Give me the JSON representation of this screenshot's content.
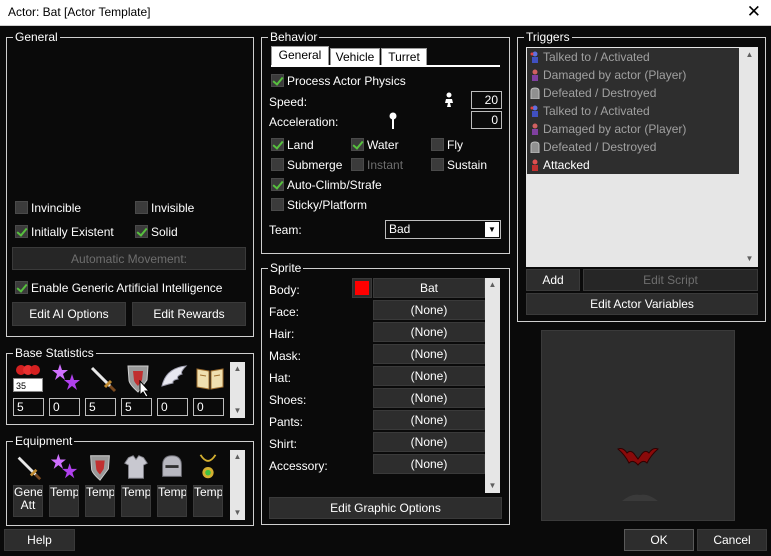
{
  "window": {
    "title": "Actor: Bat [Actor Template]"
  },
  "general": {
    "legend": "General",
    "invincible": {
      "label": "Invincible",
      "checked": false
    },
    "invisible": {
      "label": "Invisible",
      "checked": false
    },
    "initially_existent": {
      "label": "Initially Existent",
      "checked": true
    },
    "solid": {
      "label": "Solid",
      "checked": true
    },
    "automatic_movement": "Automatic Movement:",
    "enable_ai": {
      "label": "Enable Generic Artificial Intelligence",
      "checked": true
    },
    "edit_ai": "Edit AI Options",
    "edit_rewards": "Edit Rewards"
  },
  "base_stats": {
    "legend": "Base Statistics",
    "hp_badge": "35",
    "values": [
      "5",
      "0",
      "5",
      "5",
      "0",
      "0"
    ]
  },
  "equipment": {
    "legend": "Equipment",
    "slots": [
      "Generic Att",
      "Template",
      "Template",
      "Template",
      "Template",
      "Template"
    ]
  },
  "behavior": {
    "legend": "Behavior",
    "tabs": [
      "General",
      "Vehicle",
      "Turret"
    ],
    "process_physics": {
      "label": "Process Actor Physics",
      "checked": true
    },
    "speed_label": "Speed:",
    "speed_value": "20",
    "accel_label": "Acceleration:",
    "accel_value": "0",
    "land": {
      "label": "Land",
      "checked": true
    },
    "water": {
      "label": "Water",
      "checked": true
    },
    "fly": {
      "label": "Fly",
      "checked": false
    },
    "submerge": {
      "label": "Submerge",
      "checked": false
    },
    "instant": {
      "label": "Instant",
      "checked": false
    },
    "sustain": {
      "label": "Sustain",
      "checked": false
    },
    "auto_climb": {
      "label": "Auto-Climb/Strafe",
      "checked": true
    },
    "sticky": {
      "label": "Sticky/Platform",
      "checked": false
    },
    "team_label": "Team:",
    "team_value": "Bad"
  },
  "sprite": {
    "legend": "Sprite",
    "rows": [
      {
        "label": "Body:",
        "value": "Bat"
      },
      {
        "label": "Face:",
        "value": "(None)"
      },
      {
        "label": "Hair:",
        "value": "(None)"
      },
      {
        "label": "Mask:",
        "value": "(None)"
      },
      {
        "label": "Hat:",
        "value": "(None)"
      },
      {
        "label": "Shoes:",
        "value": "(None)"
      },
      {
        "label": "Pants:",
        "value": "(None)"
      },
      {
        "label": "Shirt:",
        "value": "(None)"
      },
      {
        "label": "Accessory:",
        "value": "(None)"
      }
    ],
    "body_color": "#ff0000",
    "edit_graphic": "Edit Graphic Options"
  },
  "triggers": {
    "legend": "Triggers",
    "items": [
      {
        "text": "Talked to / Activated",
        "dim": true
      },
      {
        "text": "Damaged by actor (Player)",
        "dim": true
      },
      {
        "text": "Defeated / Destroyed",
        "dim": true
      },
      {
        "text": "Talked to / Activated",
        "dim": true
      },
      {
        "text": "Damaged by actor (Player)",
        "dim": true
      },
      {
        "text": "Defeated / Destroyed",
        "dim": true
      },
      {
        "text": "Attacked",
        "dim": false
      }
    ],
    "add": "Add",
    "edit_script": "Edit Script",
    "edit_vars": "Edit Actor Variables"
  },
  "footer": {
    "help": "Help",
    "ok": "OK",
    "cancel": "Cancel"
  }
}
